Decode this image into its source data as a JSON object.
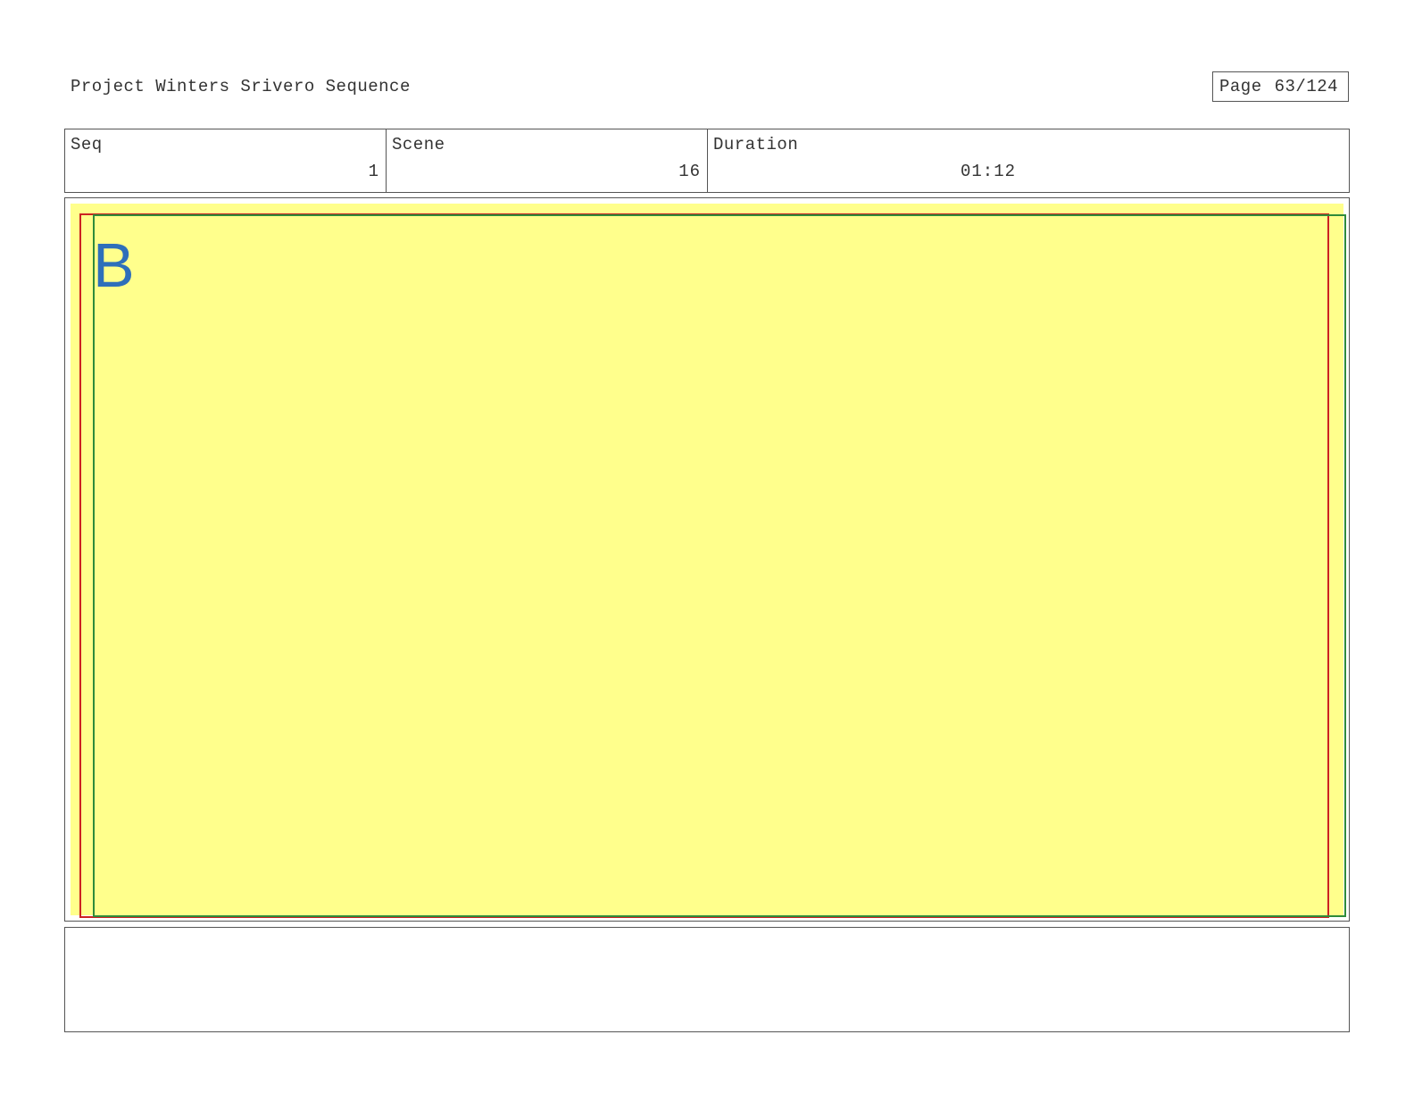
{
  "header": {
    "project_title": "Project Winters Srivero Sequence",
    "page_label": "Page",
    "page_number": "63/124"
  },
  "info": {
    "seq_label": "Seq",
    "seq_value": "1",
    "scene_label": "Scene",
    "scene_value": "16",
    "duration_label": "Duration",
    "duration_value": "01:12"
  },
  "panel": {
    "letter": "B",
    "background_color": "#ffff8c",
    "guide_colors": [
      "#cc2222",
      "#2e8b3a"
    ],
    "letter_color": "#2e6fba"
  },
  "notes": {
    "text": ""
  }
}
